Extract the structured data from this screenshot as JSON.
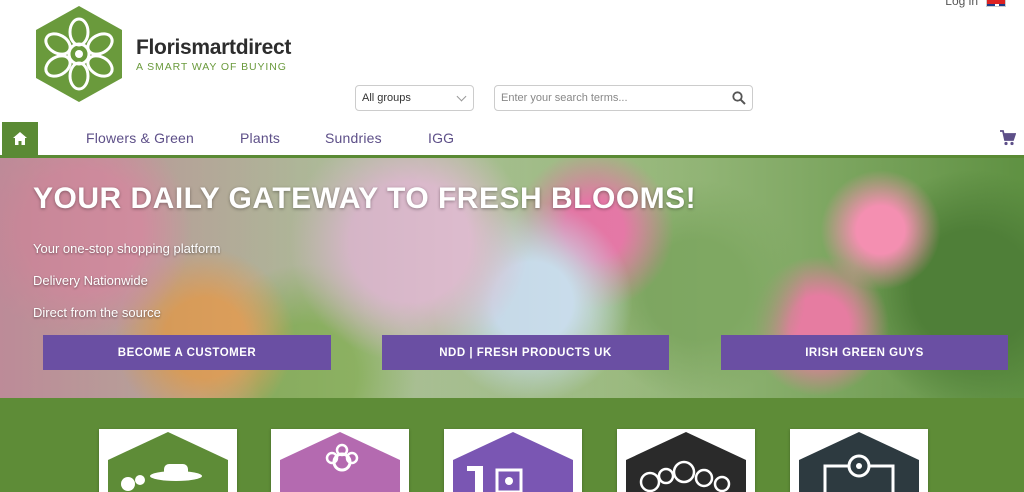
{
  "header": {
    "login_label": "Log in",
    "brand_name": "Florismartdirect",
    "brand_tagline": "A SMART WAY OF BUYING",
    "logo_icon": "flower-hexagon-logo",
    "language_flag": "uk-flag-icon"
  },
  "search": {
    "group_selected": "All groups",
    "placeholder": "Enter your search terms...",
    "value": ""
  },
  "nav": {
    "items": [
      {
        "label": "Flowers & Green"
      },
      {
        "label": "Plants"
      },
      {
        "label": "Sundries"
      },
      {
        "label": "IGG"
      }
    ]
  },
  "hero": {
    "title": "YOUR DAILY GATEWAY TO FRESH BLOOMS!",
    "lines": [
      "Your one-stop shopping platform",
      "Delivery Nationwide",
      "Direct from the source"
    ],
    "buttons": [
      {
        "label": "BECOME A CUSTOMER"
      },
      {
        "label": "NDD | FRESH PRODUCTS UK"
      },
      {
        "label": "IRISH GREEN GUYS"
      }
    ]
  },
  "colors": {
    "brand_green": "#5e8c37",
    "nav_purple": "#5d4f88",
    "button_purple": "#6a4fa3"
  },
  "categories": [
    {
      "icon": "gardener-icon",
      "color": "#5e8c37"
    },
    {
      "icon": "flower-pot-icon",
      "color": "#b46ab0"
    },
    {
      "icon": "sundries-icon",
      "color": "#7a56b3"
    },
    {
      "icon": "flower-bouquet-icon",
      "color": "#2a2a2a"
    },
    {
      "icon": "plant-box-icon",
      "color": "#2d3a40"
    }
  ]
}
